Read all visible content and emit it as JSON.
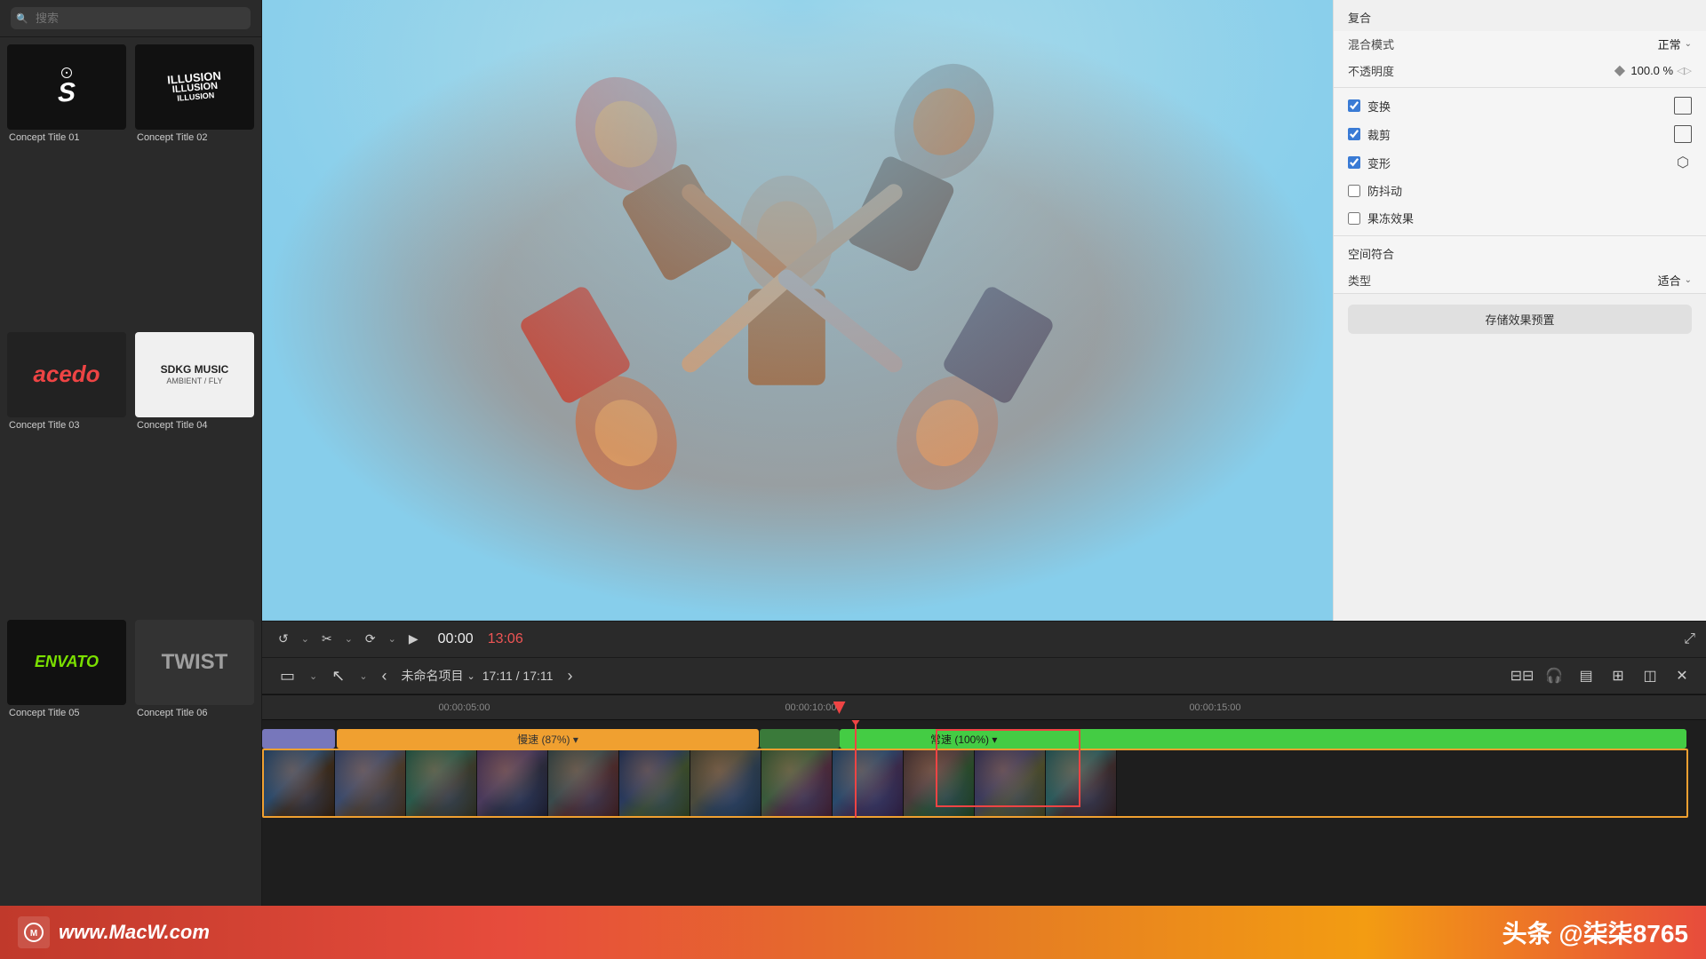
{
  "sidebar": {
    "search_placeholder": "搜索",
    "media_items": [
      {
        "id": "01",
        "label": "Concept Title 01",
        "thumb_type": "spiral"
      },
      {
        "id": "02",
        "label": "Concept Title 02",
        "thumb_type": "illusion"
      },
      {
        "id": "03",
        "label": "Concept Title 03",
        "thumb_type": "acedo"
      },
      {
        "id": "04",
        "label": "Concept Title 04",
        "thumb_type": "sdkg"
      },
      {
        "id": "05",
        "label": "Concept Title 05",
        "thumb_type": "envato"
      },
      {
        "id": "06",
        "label": "Concept Title 06",
        "thumb_type": "twist"
      }
    ]
  },
  "inspector": {
    "section_title": "复合",
    "blend_mode_label": "混合模式",
    "blend_mode_value": "正常",
    "opacity_label": "不透明度",
    "opacity_value": "100.0 %",
    "transform_label": "变换",
    "transform_checked": true,
    "crop_label": "裁剪",
    "crop_checked": true,
    "distort_label": "变形",
    "distort_checked": true,
    "stabilize_label": "防抖动",
    "stabilize_checked": false,
    "freeze_label": "果冻效果",
    "freeze_checked": false,
    "spatial_label": "空间符合",
    "type_label": "类型",
    "type_value": "适合",
    "save_preset_label": "存储效果预置"
  },
  "nav": {
    "prev_label": "‹",
    "next_label": "›",
    "project_name": "未命名项目",
    "timecode": "17:11 / 17:11"
  },
  "playback": {
    "play_icon": "▶",
    "timecode_start": "00:00",
    "timecode_end": "13:06"
  },
  "timeline": {
    "ruler_marks": [
      {
        "time": "00:00:05:00",
        "pct": 14
      },
      {
        "time": "00:00:10:00",
        "pct": 38
      },
      {
        "time": "00:00:15:00",
        "pct": 66
      }
    ],
    "speed_slow_label": "慢速 (87%) ▾",
    "speed_normal_label": "常速 (100%) ▾"
  },
  "watermark": {
    "url": "www.MacW.com",
    "credit": "头条 @柒柒8765"
  }
}
